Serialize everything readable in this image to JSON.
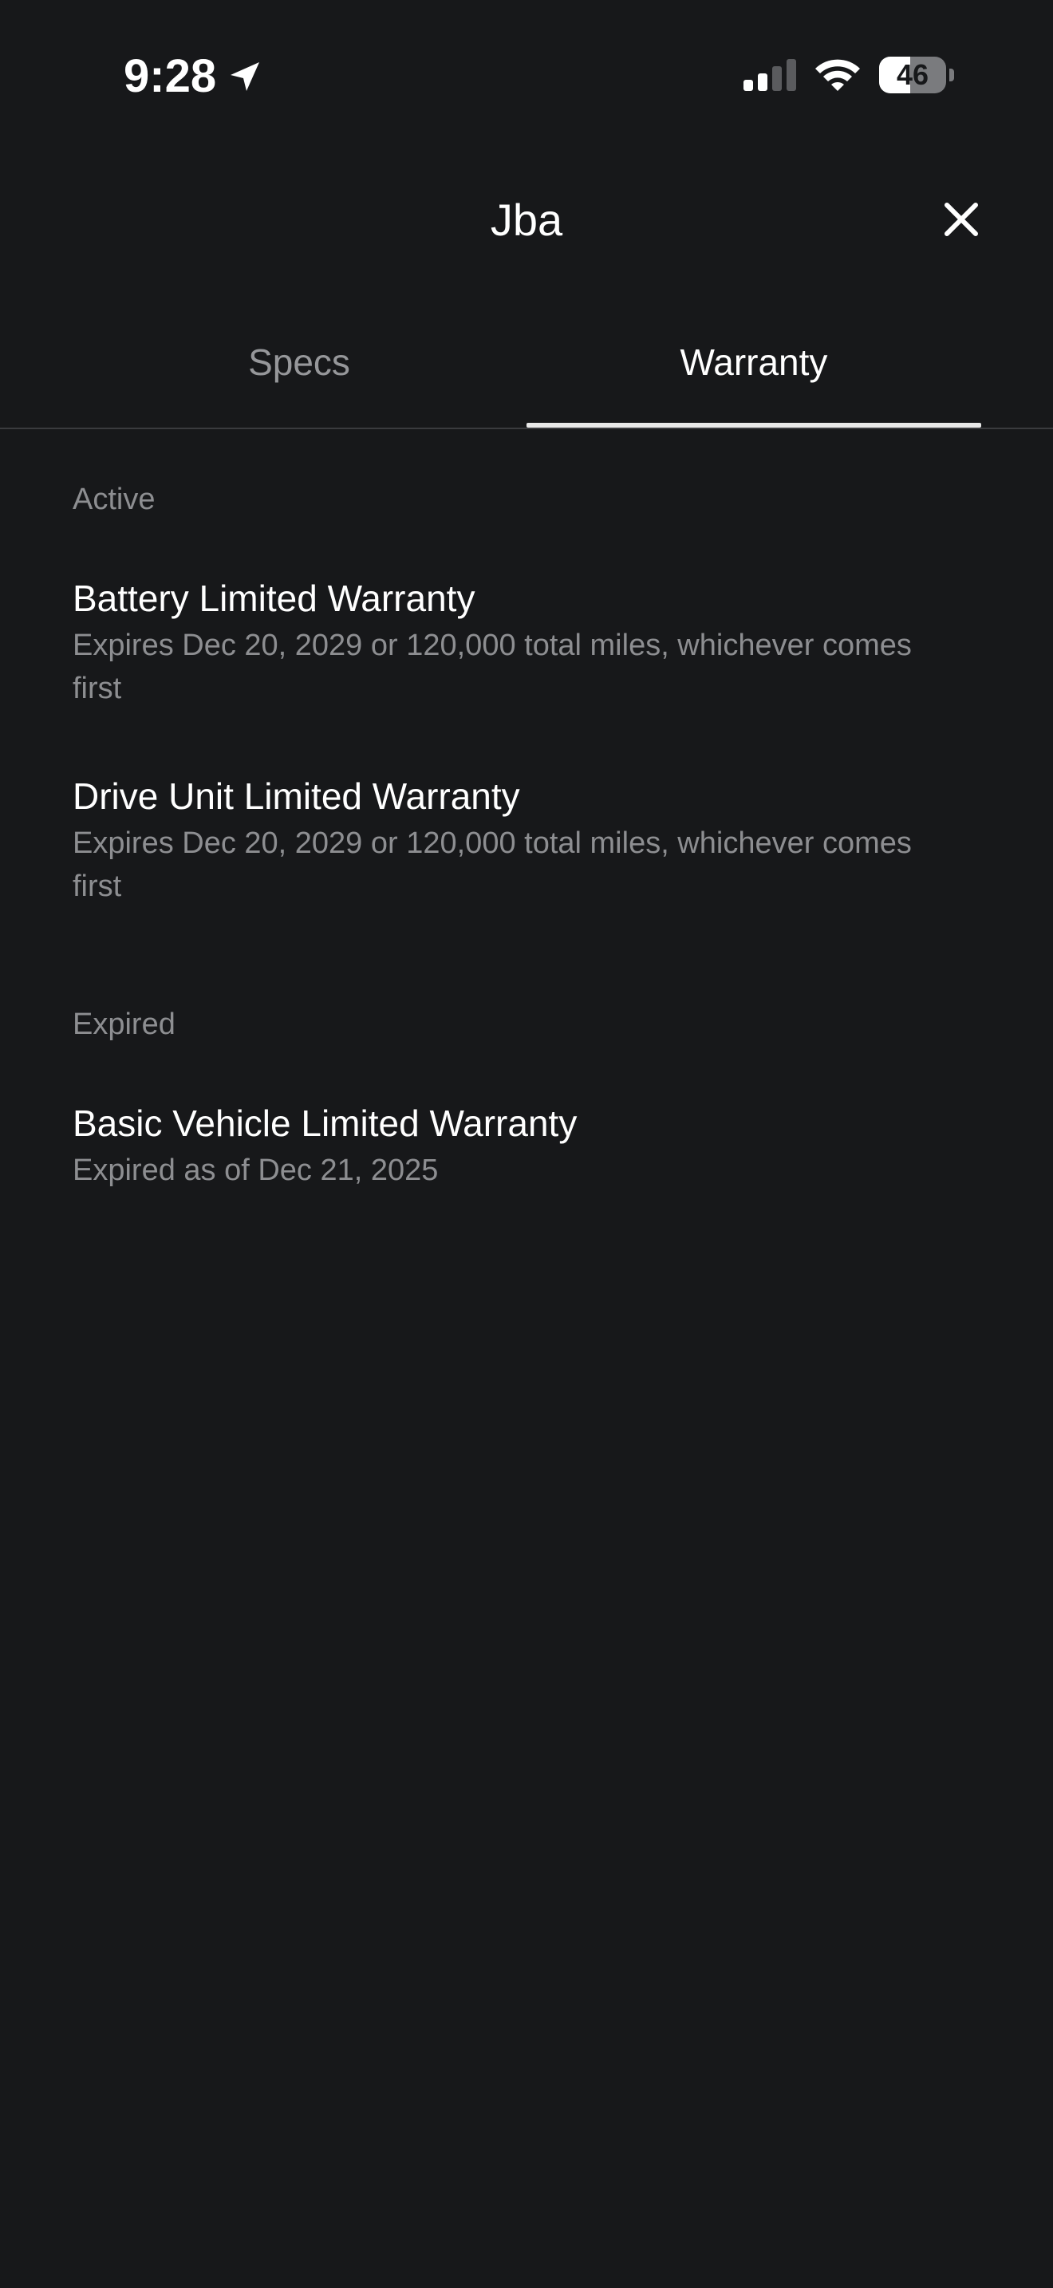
{
  "status_bar": {
    "time": "9:28",
    "battery_percent": "46",
    "battery_level": 0.46,
    "icons": [
      "location-arrow-icon",
      "cellular-signal-icon",
      "wifi-icon",
      "battery-icon"
    ]
  },
  "header": {
    "title": "Jba",
    "close_icon": "close-icon"
  },
  "tabs": [
    {
      "label": "Specs",
      "active": false
    },
    {
      "label": "Warranty",
      "active": true
    }
  ],
  "sections": {
    "active": {
      "label": "Active",
      "items": [
        {
          "title": "Battery Limited Warranty",
          "detail": "Expires Dec 20, 2029 or 120,000 total miles, whichever comes first"
        },
        {
          "title": "Drive Unit Limited Warranty",
          "detail": "Expires Dec 20, 2029 or 120,000 total miles, whichever comes first"
        }
      ]
    },
    "expired": {
      "label": "Expired",
      "items": [
        {
          "title": "Basic Vehicle Limited Warranty",
          "detail": "Expired as of Dec 21, 2025"
        }
      ]
    }
  },
  "colors": {
    "background": "#17181a",
    "primary_text": "#ffffff",
    "secondary_text": "#8d8e91",
    "tab_inactive": "#96979a",
    "tab_underline": "#e8e8e8",
    "divider": "#3a3b3e"
  }
}
